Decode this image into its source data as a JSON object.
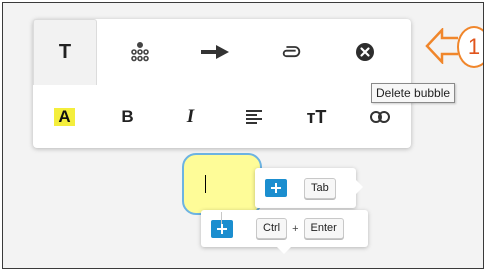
{
  "toolbar": {
    "tabs": [
      {
        "icon": "text-format-icon",
        "label": "T",
        "active": true
      },
      {
        "icon": "bubble-group-icon"
      },
      {
        "icon": "connector-arrow-icon"
      },
      {
        "icon": "attachment-icon"
      },
      {
        "icon": "delete-bubble-icon"
      }
    ],
    "format_buttons": [
      {
        "icon": "highlight-color-icon",
        "label": "A"
      },
      {
        "icon": "bold-icon",
        "label": "B"
      },
      {
        "icon": "italic-icon",
        "label": "I"
      },
      {
        "icon": "align-icon"
      },
      {
        "icon": "text-size-icon",
        "label": "тT"
      },
      {
        "icon": "link-icon"
      }
    ]
  },
  "tooltip": {
    "text": "Delete bubble"
  },
  "callout": {
    "number": "1",
    "color": "#f0862b"
  },
  "bubble": {
    "text": "",
    "fill": "#fefc98",
    "border": "#6cb3e2"
  },
  "hints": {
    "sibling": {
      "key": "Tab"
    },
    "child": {
      "keys": [
        "Ctrl",
        "Enter"
      ],
      "separator": "+"
    }
  },
  "colors": {
    "accent": "#1b8ecf",
    "highlight": "#f4ee3c"
  }
}
